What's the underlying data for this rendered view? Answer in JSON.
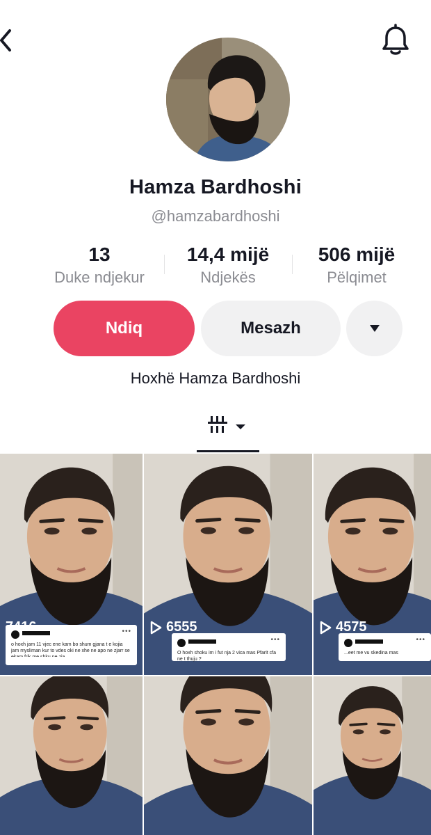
{
  "header": {
    "back_icon": "chevron-left-icon",
    "bell_icon": "bell-icon"
  },
  "profile": {
    "name": "Hamza Bardhoshi",
    "handle": "@hamzabardhoshi",
    "bio": "Hoxhë Hamza Bardhoshi"
  },
  "stats": [
    {
      "value": "13",
      "label": "Duke ndjekur"
    },
    {
      "value": "14,4 mijë",
      "label": "Ndjekës"
    },
    {
      "value": "506 mijë",
      "label": "Pëlqimet"
    }
  ],
  "actions": {
    "follow_label": "Ndiq",
    "message_label": "Mesazh",
    "more_icon": "caret-down-icon"
  },
  "tabs": {
    "videos_icon": "video-grid-icon"
  },
  "videos": [
    {
      "views": "7416",
      "caption": "o hoxh jam 11 vjec ene kam bo shum gjana t e kojia jam mysliman kur to vdes oki ne xhe ne apo ne zjarr se ekam frik me shku ne zja"
    },
    {
      "views": "6555",
      "caption": "O hoxh shoku im i fut nja 2 vica mas Pfarit cfa ne t thuju ?"
    },
    {
      "views": "4575",
      "caption": "...eet me vu skedina mas"
    },
    {
      "views": "",
      "caption": ""
    },
    {
      "views": "",
      "caption": ""
    },
    {
      "views": "",
      "caption": ""
    }
  ],
  "colors": {
    "accent": "#ea4462",
    "secondary_button": "#f1f1f2",
    "muted_text": "#8a8b91",
    "text": "#161823"
  }
}
